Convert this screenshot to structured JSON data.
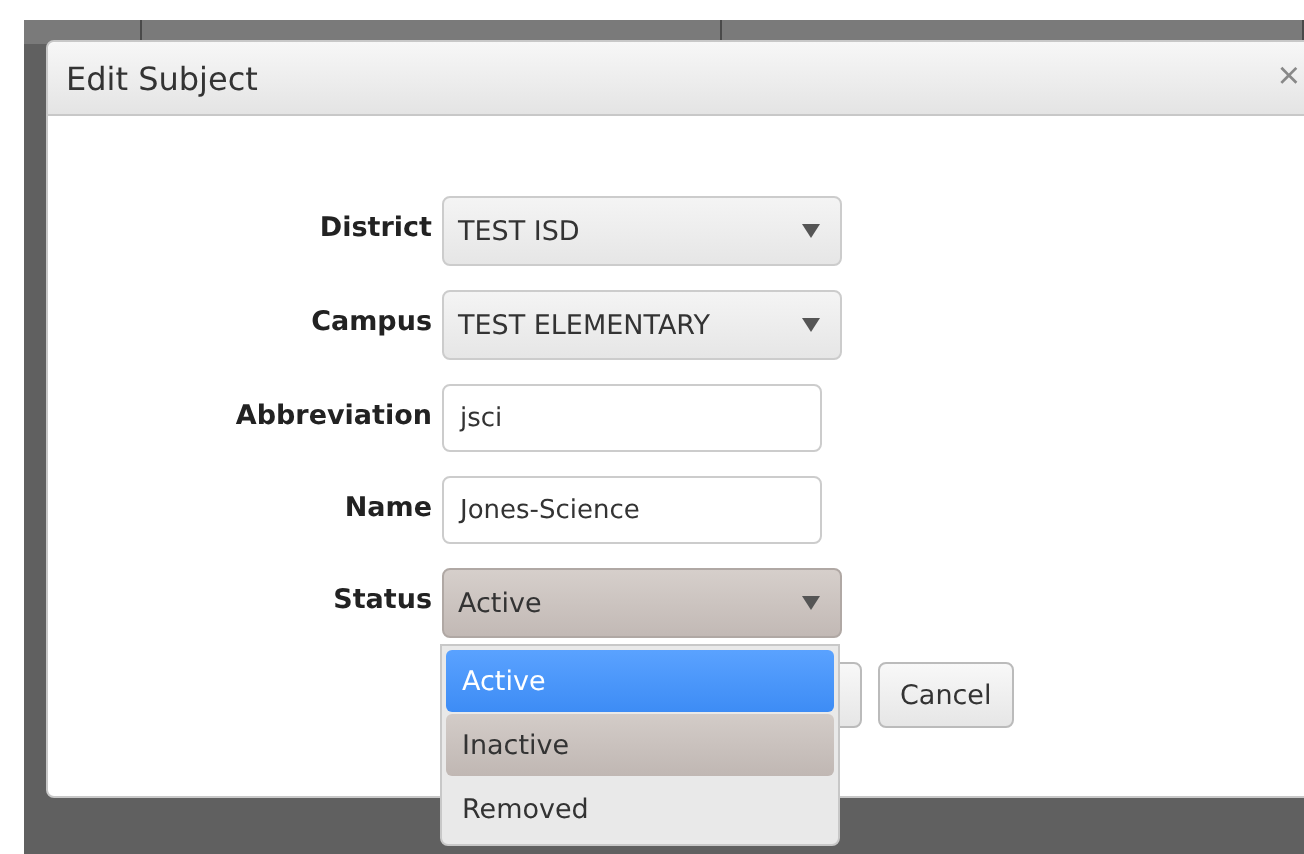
{
  "dialog": {
    "title": "Edit Subject",
    "close": "×"
  },
  "fields": [
    {
      "kind": "select",
      "label": "District",
      "value": "TEST ISD",
      "focused": false
    },
    {
      "kind": "select",
      "label": "Campus",
      "value": "TEST ELEMENTARY",
      "focused": false
    },
    {
      "kind": "input",
      "label": "Abbreviation",
      "value": "jsci"
    },
    {
      "kind": "input",
      "label": "Name",
      "value": "Jones-Science"
    },
    {
      "kind": "select",
      "label": "Status",
      "value": "Active",
      "focused": true
    }
  ],
  "dropdown": {
    "options": [
      {
        "label": "Active",
        "selected": true,
        "hovered": false
      },
      {
        "label": "Inactive",
        "selected": false,
        "hovered": true
      },
      {
        "label": "Removed",
        "selected": false,
        "hovered": false
      }
    ]
  },
  "buttons": [
    {
      "kind": "hidden"
    },
    {
      "kind": "plain",
      "label": "Cancel"
    }
  ]
}
